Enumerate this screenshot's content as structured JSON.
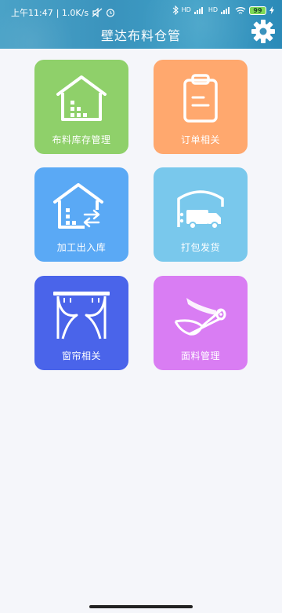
{
  "status_bar": {
    "time": "上午11:47",
    "speed": "| 1.0K/s",
    "sig1": "HD",
    "sig2": "HD",
    "battery": "99"
  },
  "header": {
    "title": "壁达布料仓管"
  },
  "tiles": [
    {
      "label": "布料库存管理",
      "color": "#8fd06a"
    },
    {
      "label": "订单相关",
      "color": "#ffa86e"
    },
    {
      "label": "加工出入库",
      "color": "#5aa9f5"
    },
    {
      "label": "打包发货",
      "color": "#79c8ec"
    },
    {
      "label": "窗帘相关",
      "color": "#4a64ea"
    },
    {
      "label": "面料管理",
      "color": "#d97df3"
    }
  ]
}
